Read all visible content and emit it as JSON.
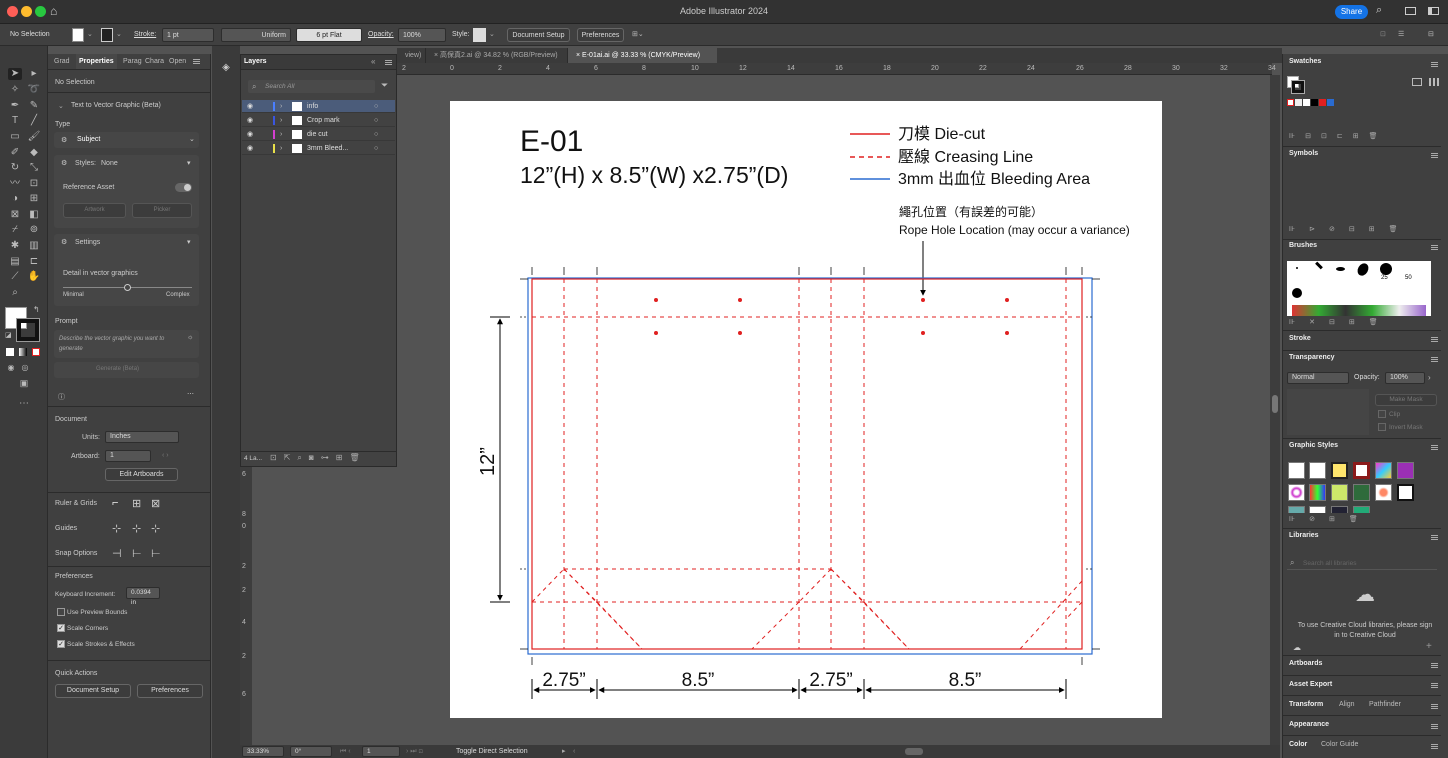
{
  "app": {
    "title": "Adobe Illustrator 2024",
    "share_label": "Share"
  },
  "control": {
    "selection": "No Selection",
    "stroke_label": "Stroke:",
    "stroke_weight": "1 pt",
    "stroke_profile": "Uniform",
    "brush": "6 pt Flat",
    "opacity_label": "Opacity:",
    "opacity": "100%",
    "style_label": "Style:",
    "doc_setup": "Document Setup",
    "preferences": "Preferences"
  },
  "tabs": [
    {
      "label": "view)"
    },
    {
      "label": "高保真2.ai @ 34.82 % (RGB/Preview)"
    },
    {
      "label": "E-01ai.ai @ 33.33 % (CMYK/Preview)"
    }
  ],
  "ruler": {
    "h": [
      "2",
      "0",
      "2",
      "4",
      "6",
      "8",
      "10",
      "12",
      "14",
      "16",
      "18",
      "20",
      "22",
      "24",
      "26",
      "28",
      "30",
      "32",
      "34"
    ],
    "v": [
      "6",
      "8",
      "0",
      "2",
      "2",
      "4",
      "2",
      "6"
    ]
  },
  "left_panel": {
    "tabs": [
      "Grad",
      "Properties",
      "Parag",
      "Chara",
      "Open"
    ],
    "no_selection": "No Selection",
    "ttv": "Text to Vector Graphic (Beta)",
    "type_label": "Type",
    "type_value": "Subject",
    "styles_label": "Styles:",
    "styles_value": "None",
    "reference_asset": "Reference Asset",
    "artwork": "Artwork",
    "picker": "Picker",
    "settings": "Settings",
    "detail": "Detail in vector graphics",
    "minimal": "Minimal",
    "complex": "Complex",
    "prompt_label": "Prompt",
    "prompt_placeholder": "Describe the vector graphic you want to generate",
    "generate": "Generate (Beta)",
    "document": "Document",
    "units_label": "Units:",
    "units": "Inches",
    "artboard_label": "Artboard:",
    "artboard": "1",
    "edit_artboards": "Edit Artboards",
    "ruler_grids": "Ruler & Grids",
    "guides": "Guides",
    "snap": "Snap Options",
    "prefs": "Preferences",
    "kb_label": "Keyboard Increment:",
    "kb_value": "0.0394 in",
    "use_preview": "Use Preview Bounds",
    "scale_corners": "Scale Corners",
    "scale_strokes": "Scale Strokes & Effects",
    "quick_actions": "Quick Actions",
    "doc_setup": "Document Setup",
    "preferences": "Preferences"
  },
  "layers": {
    "title": "Layers",
    "search": "Search All",
    "footer": "4 La...",
    "rows": [
      {
        "name": "info",
        "color": "#4a7fff"
      },
      {
        "name": "Crop mark",
        "color": "#3a56e0"
      },
      {
        "name": "die cut",
        "color": "#d43fd0"
      },
      {
        "name": "3mm Bleed...",
        "color": "#e8e04a"
      }
    ]
  },
  "artboard": {
    "code": "E-01",
    "dims": "12”(H) x 8.5”(W) x2.75”(D)",
    "legend": [
      {
        "label": "刀模  Die-cut",
        "color": "#e02020"
      },
      {
        "label": "壓線  Creasing Line",
        "color": "#e02020"
      },
      {
        "label": "3mm 出血位 Bleeding Area",
        "color": "#2a6bd0"
      }
    ],
    "note_cn": "繩孔位置（有誤差的可能）",
    "note_en": "Rope Hole Location (may occur a variance)",
    "height": "12”",
    "widths": [
      "2.75”",
      "8.5”",
      "2.75”",
      "8.5”"
    ]
  },
  "status": {
    "zoom": "33.33%",
    "rotate": "0°",
    "page": "1",
    "tool": "Toggle Direct Selection"
  },
  "right_panel": {
    "swatches": "Swatches",
    "symbols": "Symbols",
    "brushes": "Brushes",
    "brush_sizes": [
      "25",
      "50"
    ],
    "stroke": "Stroke",
    "transparency": "Transparency",
    "blend": "Normal",
    "opacity_label": "Opacity:",
    "opacity": "100%",
    "make_mask": "Make Mask",
    "clip": "Clip",
    "invert_mask": "Invert Mask",
    "graphic_styles": "Graphic Styles",
    "libraries": "Libraries",
    "search_libraries": "Search all libraries",
    "cc_note": "To use Creative Cloud libraries, please sign in to Creative Cloud",
    "artboards": "Artboards",
    "asset_export": "Asset Export",
    "transform": "Transform",
    "align": "Align",
    "pathfinder": "Pathfinder",
    "appearance": "Appearance",
    "color": "Color",
    "color_guide": "Color Guide"
  }
}
